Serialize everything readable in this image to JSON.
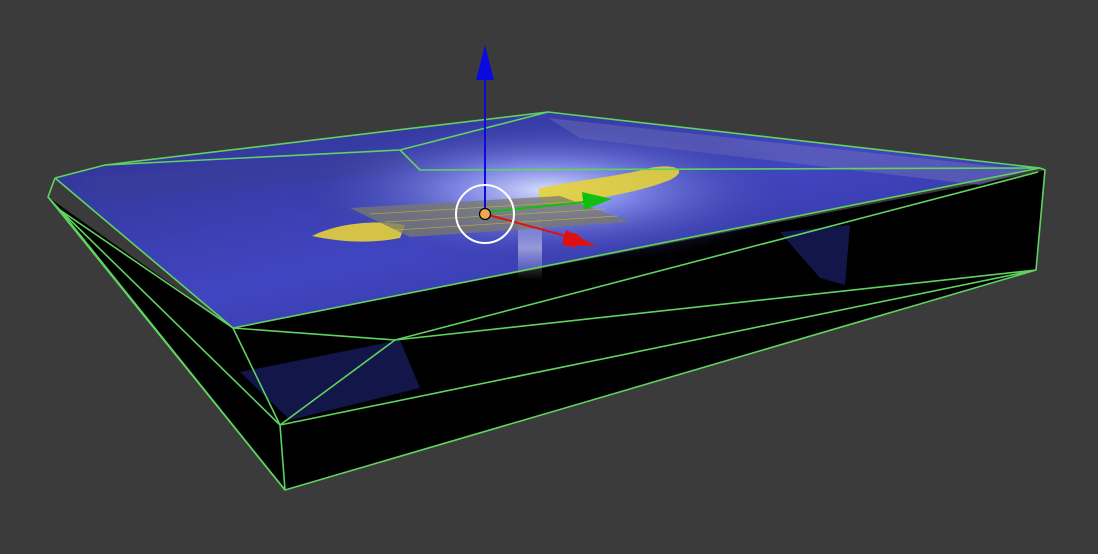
{
  "viewport": {
    "background_color": "#3b3b3b",
    "wire_color": "#5fd35f",
    "glass_tint_color": "#3a3ec0",
    "highlight_color": "#e4d23a"
  },
  "gizmo": {
    "x_axis_color": "#e01010",
    "y_axis_color": "#10c010",
    "z_axis_color": "#0a0ae0",
    "center_ring_color": "#ffffff",
    "origin_color": "#f2a553",
    "icons": {
      "x_handle": "arrow-head-icon",
      "y_handle": "arrow-head-icon",
      "z_handle": "arrow-head-icon",
      "rotate_ring": "circle-ring-icon",
      "origin": "dot-icon"
    }
  }
}
